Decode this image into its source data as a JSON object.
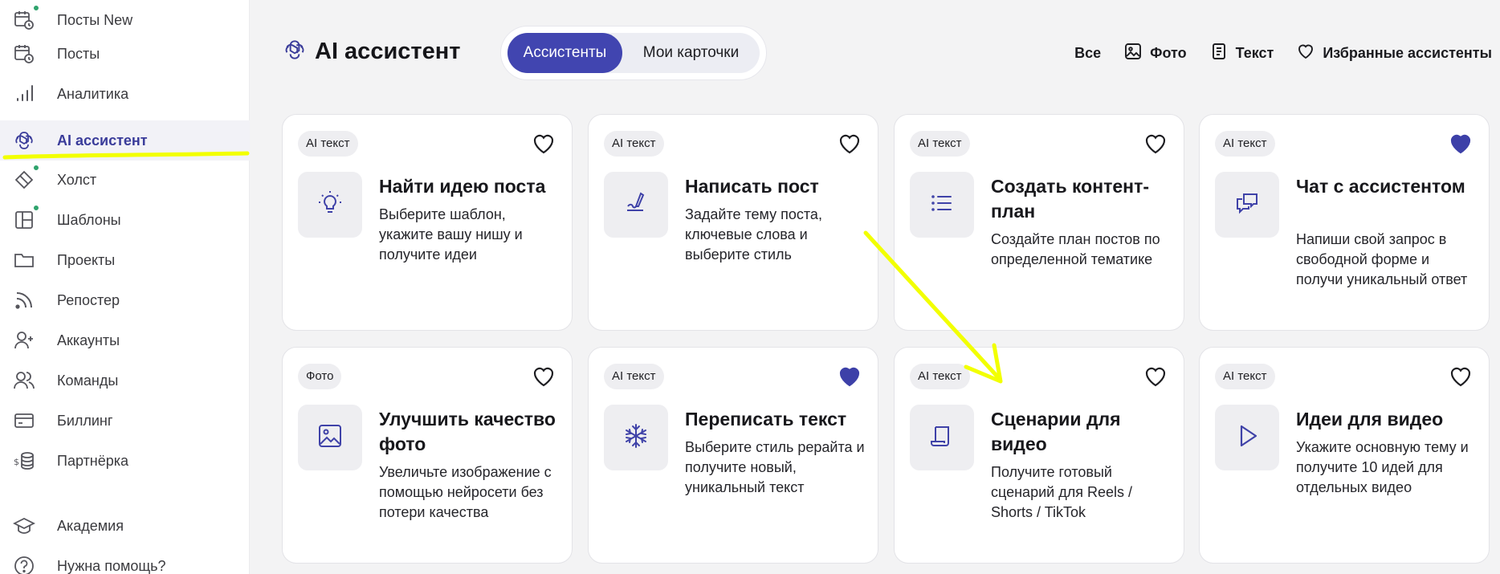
{
  "sidebar": {
    "items": [
      {
        "label": "Посты New",
        "icon": "calendar-clock-icon",
        "dot": true
      },
      {
        "label": "Посты",
        "icon": "calendar-clock-icon",
        "dot": false
      },
      {
        "label": "Аналитика",
        "icon": "bar-chart-icon",
        "dot": false
      },
      {
        "label": "AI ассистент",
        "icon": "ai-swirl-icon",
        "dot": false,
        "active": true
      },
      {
        "label": "Холст",
        "icon": "canvas-icon",
        "dot": true
      },
      {
        "label": "Шаблоны",
        "icon": "layout-template-icon",
        "dot": true
      },
      {
        "label": "Проекты",
        "icon": "folder-icon",
        "dot": false
      },
      {
        "label": "Репостер",
        "icon": "rss-icon",
        "dot": false
      },
      {
        "label": "Аккаунты",
        "icon": "user-plus-icon",
        "dot": false
      },
      {
        "label": "Команды",
        "icon": "users-icon",
        "dot": false
      },
      {
        "label": "Биллинг",
        "icon": "credit-card-icon",
        "dot": false
      },
      {
        "label": "Партнёрка",
        "icon": "dollar-coins-icon",
        "dot": false
      },
      {
        "label": "Академия",
        "icon": "graduation-cap-icon",
        "dot": false
      },
      {
        "label": "Нужна помощь?",
        "icon": "help-circle-icon",
        "dot": false
      }
    ]
  },
  "header": {
    "title": "AI ассистент",
    "title_icon": "ai-swirl-icon",
    "tabs": [
      {
        "label": "Ассистенты",
        "active": true
      },
      {
        "label": "Мои карточки",
        "active": false
      }
    ],
    "filters": [
      {
        "label": "Все",
        "icon": ""
      },
      {
        "label": "Фото",
        "icon": "image-icon"
      },
      {
        "label": "Текст",
        "icon": "document-icon"
      },
      {
        "label": "Избранные ассистенты",
        "icon": "heart-icon"
      }
    ]
  },
  "cards": [
    {
      "badge": "AI текст",
      "title": "Найти идею поста",
      "description": "Выберите шаблон, укажите вашу нишу и получите идеи",
      "icon": "lightbulb-icon",
      "favorite": false
    },
    {
      "badge": "AI текст",
      "title": "Написать пост",
      "description": "Задайте тему поста, ключевые слова и выберите стиль",
      "icon": "pen-writing-icon",
      "favorite": false
    },
    {
      "badge": "AI текст",
      "title": "Создать контент-план",
      "description": "Создайте план постов по определенной тематике",
      "icon": "list-icon",
      "favorite": false
    },
    {
      "badge": "AI текст",
      "title": "Чат с ассистентом",
      "description": "Напиши свой запрос в свободной форме и получи уникальный ответ",
      "icon": "chat-bubbles-icon",
      "favorite": true
    },
    {
      "badge": "Фото",
      "title": "Улучшить качество фото",
      "description": "Увеличьте изображение с помощью нейросети без потери качества",
      "icon": "image-icon",
      "favorite": false
    },
    {
      "badge": "AI текст",
      "title": "Переписать текст",
      "description": "Выберите стиль рерайта и получите новый, уникальный текст",
      "icon": "snowflake-icon",
      "favorite": true
    },
    {
      "badge": "AI текст",
      "title": "Сценарии для видео",
      "description": "Получите готовый сценарий для Reels / Shorts / TikTok",
      "icon": "script-scroll-icon",
      "favorite": false
    },
    {
      "badge": "AI текст",
      "title": "Идеи для видео",
      "description": "Укажите основную тему и получите 10 идей для отдельных видео",
      "icon": "play-icon",
      "favorite": false
    }
  ],
  "colors": {
    "accent": "#4145b0",
    "favorite": "#3d40a8",
    "highlight": "#f2ff00",
    "dot": "#2fa36d"
  }
}
